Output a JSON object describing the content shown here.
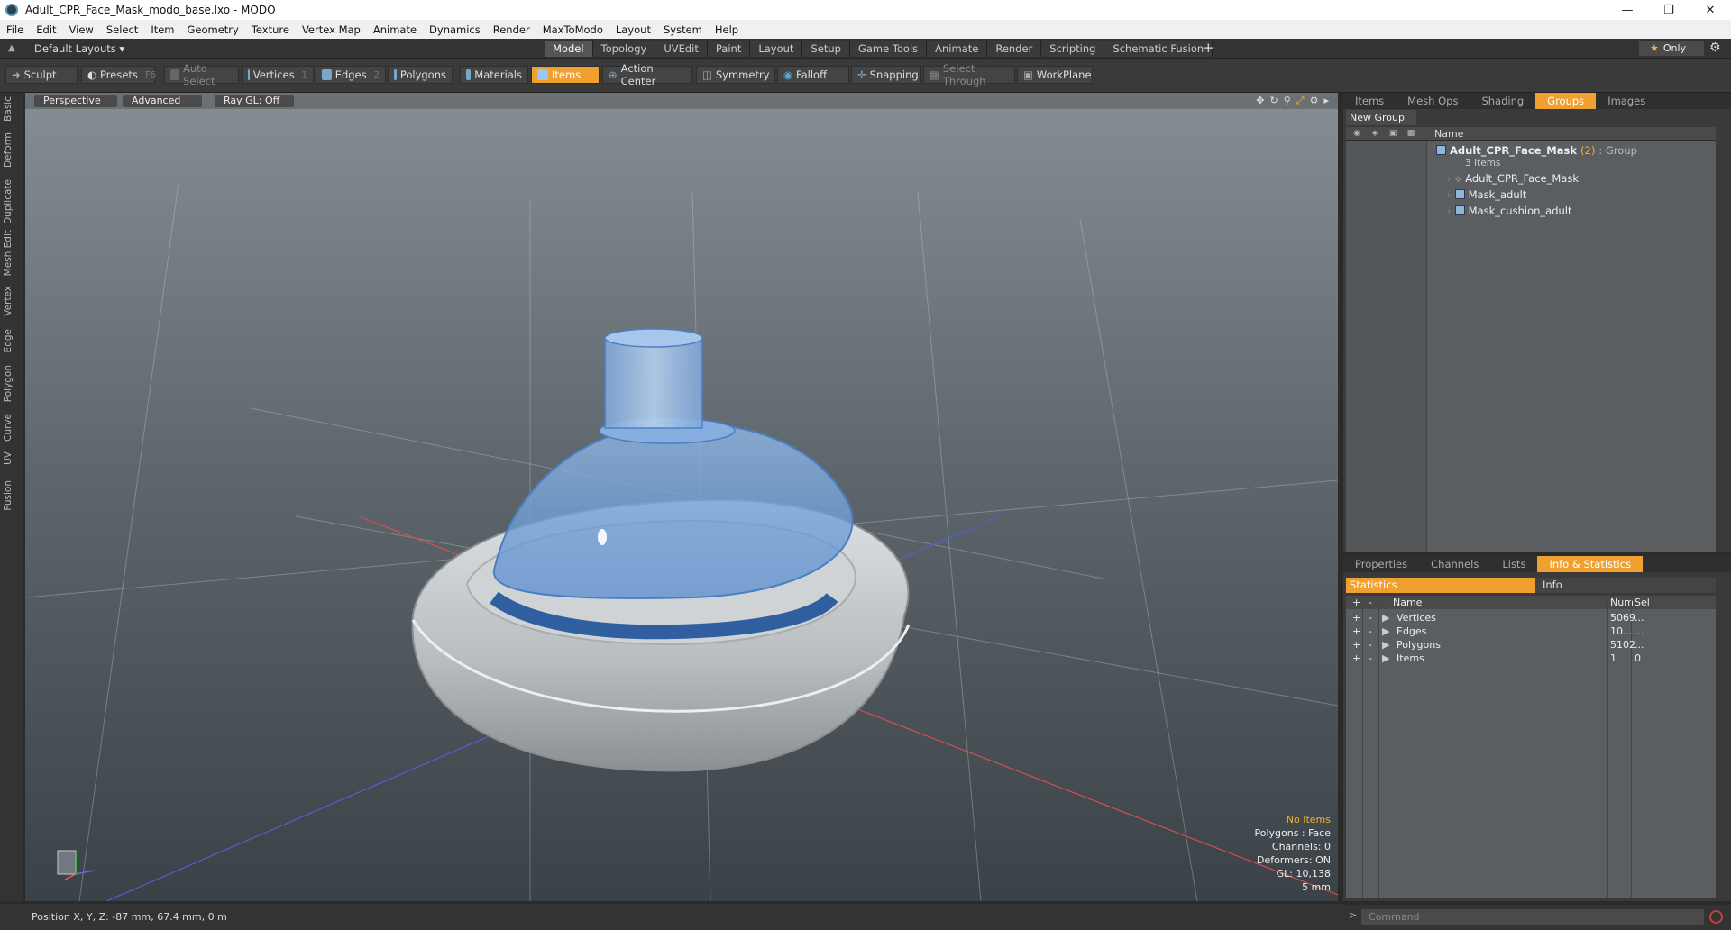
{
  "window": {
    "title": "Adult_CPR_Face_Mask_modo_base.lxo - MODO"
  },
  "menu": [
    "File",
    "Edit",
    "View",
    "Select",
    "Item",
    "Geometry",
    "Texture",
    "Vertex Map",
    "Animate",
    "Dynamics",
    "Render",
    "MaxToModo",
    "Layout",
    "System",
    "Help"
  ],
  "layouts": {
    "label": "Default Layouts ▾"
  },
  "tabs": [
    "Model",
    "Topology",
    "UVEdit",
    "Paint",
    "Layout",
    "Setup",
    "Game Tools",
    "Animate",
    "Render",
    "Scripting",
    "Schematic Fusion"
  ],
  "tab_add": "+",
  "only": "Only",
  "toolbar": {
    "sculpt": "Sculpt",
    "presets": "Presets",
    "presets_key": "F6",
    "auto_select": "Auto Select",
    "vertices": "Vertices",
    "vertices_key": "1",
    "edges": "Edges",
    "edges_key": "2",
    "polygons": "Polygons",
    "materials": "Materials",
    "items": "Items",
    "action_center": "Action Center",
    "symmetry": "Symmetry",
    "falloff": "Falloff",
    "snapping": "Snapping",
    "select_through": "Select Through",
    "workplane": "WorkPlane"
  },
  "left_tabs": [
    "Basic",
    "Deform",
    "Duplicate",
    "Mesh Edit",
    "Vertex",
    "Edge",
    "Polygon",
    "Curve",
    "UV",
    "Fusion"
  ],
  "viewport": {
    "perspective": "Perspective",
    "advanced": "Advanced",
    "raygl": "Ray GL: Off",
    "info": {
      "no_items": "No Items",
      "polygons": "Polygons : Face",
      "channels": "Channels: 0",
      "deformers": "Deformers: ON",
      "gl": "GL: 10,138",
      "scale": "5 mm"
    }
  },
  "status": {
    "position": "Position X, Y, Z:  -87 mm, 67.4 mm, 0 m"
  },
  "top_panel": {
    "tabs": [
      "Items",
      "Mesh Ops",
      "Shading",
      "Groups",
      "Images"
    ],
    "active": "Groups",
    "new_group": "New Group",
    "col_name": "Name",
    "group_name": "Adult_CPR_Face_Mask",
    "group_count": "(2)",
    "group_type": ": Group",
    "group_sub": "3 Items",
    "items": [
      "Adult_CPR_Face_Mask",
      "Mask_adult",
      "Mask_cushion_adult"
    ]
  },
  "bottom_panel": {
    "tabs": [
      "Properties",
      "Channels",
      "Lists",
      "Info & Statistics"
    ],
    "active": "Info & Statistics",
    "statistics": "Statistics",
    "info": "Info",
    "cols": {
      "name": "Name",
      "num": "Num",
      "sel": "Sel"
    },
    "rows": [
      {
        "name": "Vertices",
        "num": "5069",
        "sel": "..."
      },
      {
        "name": "Edges",
        "num": "10...",
        "sel": "..."
      },
      {
        "name": "Polygons",
        "num": "5102",
        "sel": "..."
      },
      {
        "name": "Items",
        "num": "1",
        "sel": "0"
      }
    ]
  },
  "command": {
    "placeholder": "Command"
  }
}
